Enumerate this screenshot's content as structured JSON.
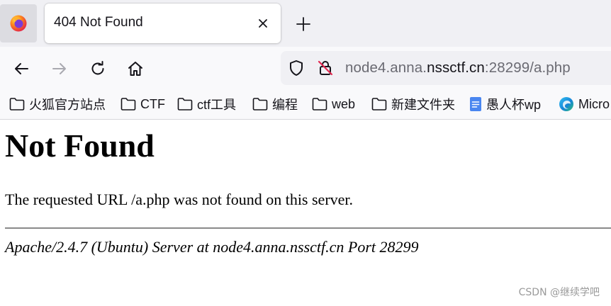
{
  "browser": {
    "tab": {
      "title": "404 Not Found"
    },
    "address_bar": {
      "url_prefix": "node4.anna.",
      "url_domain": "nssctf.cn",
      "url_suffix": ":28299/a.php"
    },
    "bookmarks": [
      {
        "label": "火狐官方站点",
        "icon": "folder-icon"
      },
      {
        "label": "CTF",
        "icon": "folder-icon"
      },
      {
        "label": "ctf工具",
        "icon": "folder-icon"
      },
      {
        "label": "编程",
        "icon": "folder-icon"
      },
      {
        "label": "web",
        "icon": "folder-icon"
      },
      {
        "label": "新建文件夹",
        "icon": "folder-icon"
      },
      {
        "label": "愚人杯wp",
        "icon": "doc-icon"
      },
      {
        "label": "Micro",
        "icon": "edge-icon"
      }
    ]
  },
  "page": {
    "heading": "Not Found",
    "message": "The requested URL /a.php was not found on this server.",
    "address": "Apache/2.4.7 (Ubuntu) Server at node4.anna.nssctf.cn Port 28299"
  },
  "watermark": "CSDN @继续学吧",
  "colors": {
    "tabbar_bg": "#f0f0f4",
    "toolbar_bg": "#f9f9fb",
    "urlbar_bg": "#f0f0f4",
    "text": "#15141a",
    "muted": "#6a6a72",
    "doc_icon_blue": "#4a86f0",
    "watermark": "#9a9a9a"
  }
}
